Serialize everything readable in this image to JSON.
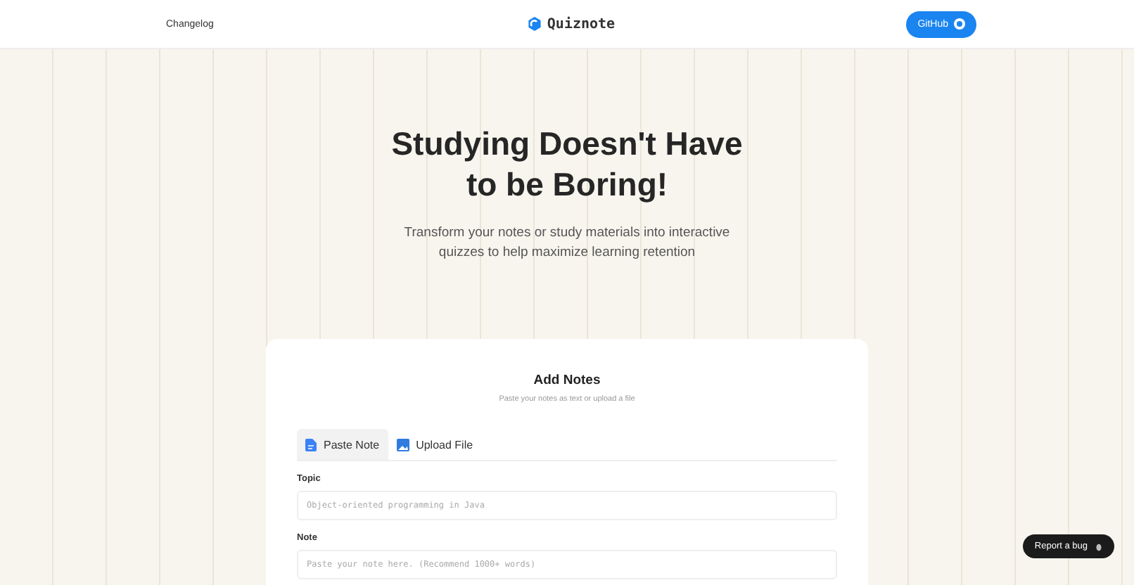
{
  "header": {
    "link": "Changelog",
    "logo": "Quiznote",
    "github_button": "GitHub"
  },
  "hero": {
    "title": "Studying Doesn't Have to be Boring!",
    "subtitle": "Transform your notes or study materials into interactive quizzes to help maximize learning retention"
  },
  "card": {
    "title": "Add Notes",
    "subtitle": "Paste your notes as text or upload a file",
    "tabs": [
      {
        "label": "Paste Note",
        "kind": "document",
        "selected": true
      },
      {
        "label": "Upload File",
        "kind": "image",
        "selected": false
      }
    ],
    "fields": [
      {
        "label": "Topic",
        "placeholder": "Object-oriented programming in Java"
      },
      {
        "label": "Note",
        "placeholder": "Paste your note here. (Recommend 1000+ words)"
      }
    ]
  },
  "report_button": "Report a bug"
}
